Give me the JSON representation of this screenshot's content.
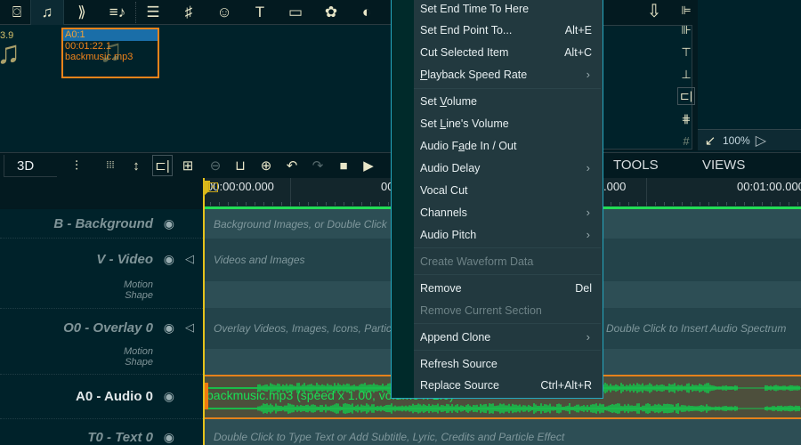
{
  "library_toolbar": {
    "icons": [
      {
        "name": "camera-icon",
        "glyph": "⌼"
      },
      {
        "name": "music-note-icon",
        "glyph": "♫"
      },
      {
        "name": "transition-icon",
        "glyph": "⟫"
      },
      {
        "name": "music-playlist-icon",
        "glyph": "≡♪"
      },
      {
        "name": "list-icon",
        "glyph": "☰"
      },
      {
        "name": "music-sheet-icon",
        "glyph": "♯"
      },
      {
        "name": "smiley-icon",
        "glyph": "☺"
      },
      {
        "name": "text-icon",
        "glyph": "T"
      },
      {
        "name": "battery-icon",
        "glyph": "▭"
      },
      {
        "name": "flower-icon",
        "glyph": "✿"
      },
      {
        "name": "contrast-icon",
        "glyph": "◐"
      }
    ]
  },
  "library": {
    "partial_item_label": "3.9",
    "selected_item": {
      "track": "A0:1",
      "duration": "00:01:22.1",
      "filename": "backmusic.mp3"
    }
  },
  "right_panel": {
    "download_glyph": "⇩",
    "vertical_tools": [
      {
        "name": "align-left-icon",
        "glyph": "⊫"
      },
      {
        "name": "align-right-icon",
        "glyph": "⊪"
      },
      {
        "name": "align-top-icon",
        "glyph": "⊤"
      },
      {
        "name": "align-bottom-icon",
        "glyph": "⊥"
      },
      {
        "name": "fit-frame-icon",
        "glyph": "⊏|"
      },
      {
        "name": "grid-icon",
        "glyph": "⋕"
      },
      {
        "name": "grid-lines-icon",
        "glyph": "#"
      }
    ],
    "zoom_level": "100%",
    "zoom_glyph": "↙",
    "play_glyph": "▷"
  },
  "timeline_toolbar": {
    "btn_3d": "3D",
    "icons": [
      {
        "name": "align-lines-icon",
        "glyph": "⫶"
      },
      {
        "name": "dots-grid-icon",
        "glyph": "⁞⁞⁞"
      },
      {
        "name": "vertical-resize-icon",
        "glyph": "↕"
      },
      {
        "name": "fit-frame-icon",
        "glyph": "⊏|"
      },
      {
        "name": "split-box-icon",
        "glyph": "⊞"
      },
      {
        "name": "zoom-out-icon",
        "glyph": "⊖"
      },
      {
        "name": "ruler-icon",
        "glyph": "⊔"
      },
      {
        "name": "zoom-in-icon",
        "glyph": "⊕"
      },
      {
        "name": "undo-icon",
        "glyph": "↶"
      },
      {
        "name": "redo-icon",
        "glyph": "↷"
      },
      {
        "name": "stop-icon",
        "glyph": "■"
      },
      {
        "name": "play-icon",
        "glyph": "▶"
      }
    ],
    "tabs": [
      "TOOLS",
      "VIEWS"
    ]
  },
  "ruler": {
    "labels": [
      "00:00:00.000",
      "00:00:30.000",
      "00:01:00.000"
    ],
    "visible_label_1": "00:00:00.000",
    "visible_label_2": "00",
    "visible_label_3": ".000",
    "visible_label_4": "00:01:00.000"
  },
  "tracks": [
    {
      "id": "background",
      "name": "B - Background",
      "hint": "Background Images, or Double Click",
      "has_speaker": false
    },
    {
      "id": "video",
      "name": "V - Video",
      "hint": "Videos and Images",
      "sub": [
        "Motion",
        "Shape"
      ],
      "has_speaker": true
    },
    {
      "id": "overlay0",
      "name": "O0 - Overlay 0",
      "hint": "Overlay Videos, Images, Icons, Partic",
      "hint_right": "Double Click to Insert Audio Spectrum",
      "sub": [
        "Motion",
        "Shape"
      ],
      "has_speaker": true
    },
    {
      "id": "audio0",
      "name": "A0 - Audio 0",
      "clip_label": "backmusic.mp3  (speed x 1.00, volume x 1.0)",
      "active": true
    },
    {
      "id": "text0",
      "name": "T0 - Text 0",
      "hint": "Double Click to Type Text or Add Subtitle, Lyric, Credits and Particle Effect"
    }
  ],
  "context_menu": {
    "items": [
      {
        "label": "Set End Time To Here",
        "shortcut": "",
        "submenu": false,
        "disabled": false
      },
      {
        "label": "Set End Point To...",
        "shortcut": "Alt+E",
        "submenu": false,
        "disabled": false
      },
      {
        "label": "Cut Selected Item",
        "shortcut": "Alt+C",
        "submenu": false,
        "disabled": false
      },
      {
        "label": "Playback Speed Rate",
        "shortcut": "",
        "submenu": true,
        "disabled": false
      },
      {
        "label": "Set Volume",
        "shortcut": "",
        "submenu": false,
        "disabled": false
      },
      {
        "label": "Set Line's Volume",
        "shortcut": "",
        "submenu": false,
        "disabled": false
      },
      {
        "label": "Audio Fade In / Out",
        "shortcut": "",
        "submenu": false,
        "disabled": false
      },
      {
        "label": "Audio Delay",
        "shortcut": "",
        "submenu": true,
        "disabled": false
      },
      {
        "label": "Vocal Cut",
        "shortcut": "",
        "submenu": false,
        "disabled": false
      },
      {
        "label": "Channels",
        "shortcut": "",
        "submenu": true,
        "disabled": false
      },
      {
        "label": "Audio Pitch",
        "shortcut": "",
        "submenu": true,
        "disabled": false
      },
      {
        "label": "Create Waveform Data",
        "shortcut": "",
        "submenu": false,
        "disabled": true
      },
      {
        "label": "Remove",
        "shortcut": "Del",
        "submenu": false,
        "disabled": false
      },
      {
        "label": "Remove Current Section",
        "shortcut": "",
        "submenu": false,
        "disabled": true
      },
      {
        "label": "Append Clone",
        "shortcut": "",
        "submenu": true,
        "disabled": false
      },
      {
        "label": "Refresh Source",
        "shortcut": "",
        "submenu": false,
        "disabled": false
      },
      {
        "label": "Replace Source",
        "shortcut": "Ctrl+Alt+R",
        "submenu": false,
        "disabled": false
      }
    ],
    "arrow_glyph": "›"
  },
  "colors": {
    "accent_orange": "#f0831a",
    "waveform_green": "#19e055",
    "playhead_yellow": "#e6c21a",
    "menu_border": "#25a8c0",
    "selection_blue": "#1a6ea8"
  }
}
